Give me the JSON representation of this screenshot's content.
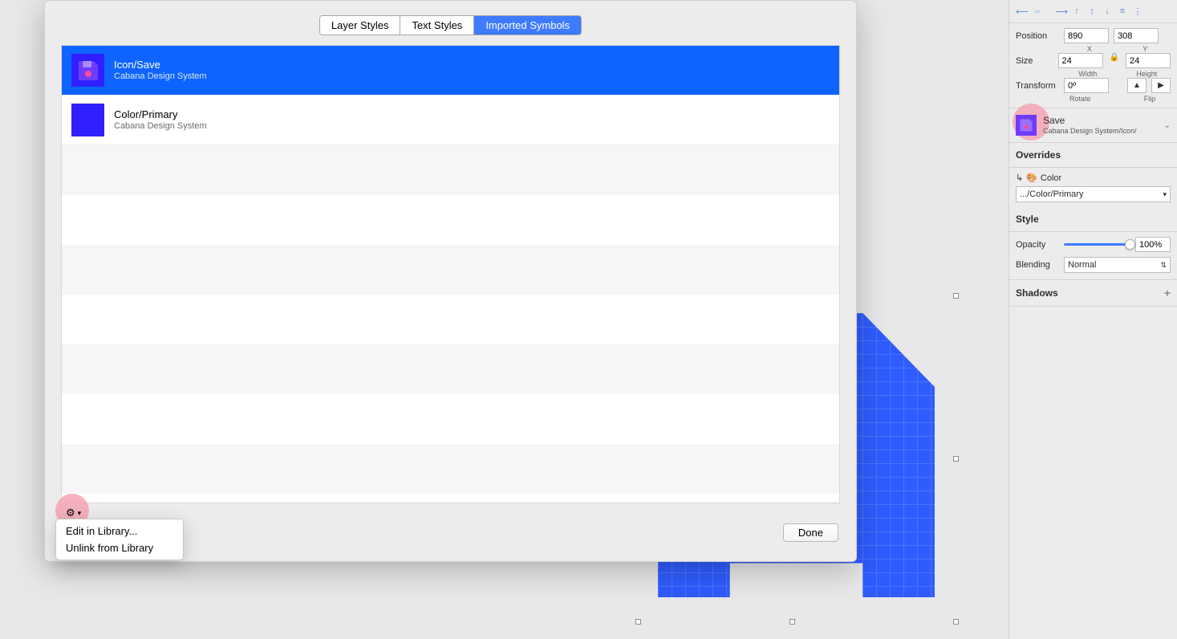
{
  "dialog": {
    "tabs": {
      "layer": "Layer Styles",
      "text": "Text Styles",
      "imported": "Imported Symbols"
    },
    "items": [
      {
        "title": "Icon/Save",
        "sub": "Cabana Design System"
      },
      {
        "title": "Color/Primary",
        "sub": "Cabana Design System"
      }
    ],
    "menu": {
      "edit": "Edit in Library...",
      "unlink": "Unlink from Library"
    },
    "done": "Done"
  },
  "inspector": {
    "position": {
      "label": "Position",
      "x": "890",
      "y": "308",
      "xl": "X",
      "yl": "Y"
    },
    "size": {
      "label": "Size",
      "w": "24",
      "h": "24",
      "wl": "Width",
      "hl": "Height"
    },
    "transform": {
      "label": "Transform",
      "rotate": "0º",
      "rlabel": "Rotate",
      "fliplabel": "Flip"
    },
    "symbol": {
      "title": "Save",
      "path": "Cabana Design System/Icon/"
    },
    "overrides": {
      "head": "Overrides",
      "label": "Color",
      "value": ".../Color/Primary"
    },
    "style": {
      "head": "Style",
      "opacity": "Opacity",
      "opval": "100%",
      "blend": "Blending",
      "blendval": "Normal"
    },
    "shadows": {
      "head": "Shadows"
    }
  }
}
